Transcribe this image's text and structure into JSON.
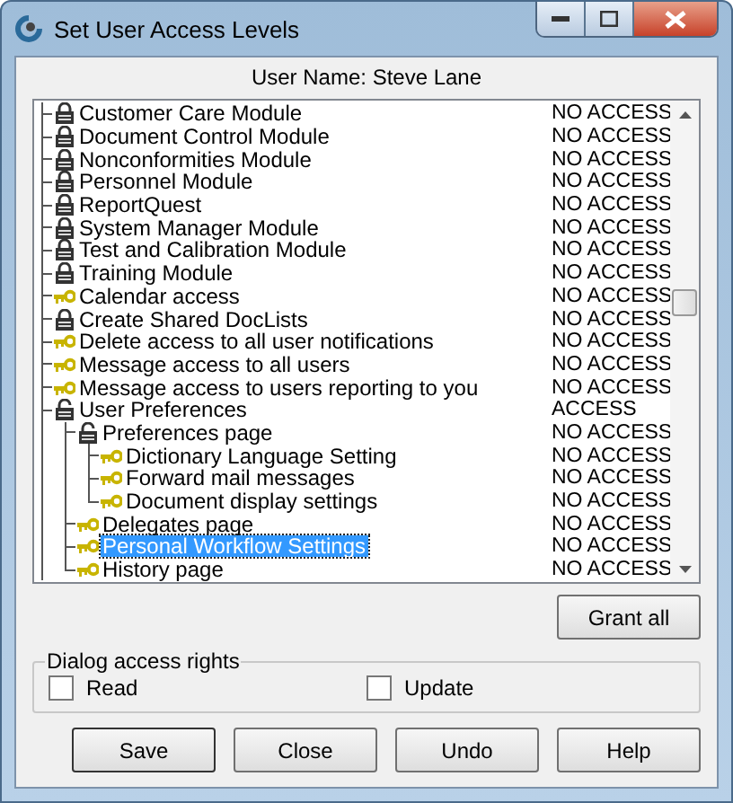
{
  "window": {
    "title": "Set User Access Levels"
  },
  "user_name": "User Name: Steve Lane",
  "tree": [
    {
      "label": "Customer Care Module",
      "kind": "lock",
      "access": "NO ACCESS",
      "selected": false
    },
    {
      "label": "Document Control Module",
      "kind": "lock",
      "access": "NO ACCESS",
      "selected": false
    },
    {
      "label": "Nonconformities Module",
      "kind": "lock",
      "access": "NO ACCESS",
      "selected": false
    },
    {
      "label": "Personnel Module",
      "kind": "lock",
      "access": "NO ACCESS",
      "selected": false
    },
    {
      "label": "ReportQuest",
      "kind": "lock",
      "access": "NO ACCESS",
      "selected": false
    },
    {
      "label": "System Manager Module",
      "kind": "lock",
      "access": "NO ACCESS",
      "selected": false
    },
    {
      "label": "Test and Calibration Module",
      "kind": "lock",
      "access": "NO ACCESS",
      "selected": false
    },
    {
      "label": "Training Module",
      "kind": "lock",
      "access": "NO ACCESS",
      "selected": false
    },
    {
      "label": "Calendar access",
      "kind": "key",
      "access": "NO ACCESS",
      "selected": false
    },
    {
      "label": "Create Shared DocLists",
      "kind": "lock",
      "access": "NO ACCESS",
      "selected": false
    },
    {
      "label": "Delete access to all user notifications",
      "kind": "key",
      "access": "NO ACCESS",
      "selected": false
    },
    {
      "label": "Message access to all users",
      "kind": "key",
      "access": "NO ACCESS",
      "selected": false
    },
    {
      "label": "Message access to users reporting to you",
      "kind": "key",
      "access": "NO ACCESS",
      "selected": false
    },
    {
      "label": "User Preferences",
      "kind": "unlock",
      "access": "ACCESS",
      "selected": false,
      "children": [
        {
          "label": "Preferences page",
          "kind": "unlock",
          "access": "NO ACCESS",
          "selected": false,
          "children": [
            {
              "label": "Dictionary Language Setting",
              "kind": "key",
              "access": "NO ACCESS",
              "selected": false
            },
            {
              "label": "Forward mail messages",
              "kind": "key",
              "access": "NO ACCESS",
              "selected": false
            },
            {
              "label": "Document display settings",
              "kind": "key",
              "access": "NO ACCESS",
              "selected": false
            }
          ]
        },
        {
          "label": "Delegates page",
          "kind": "key",
          "access": "NO ACCESS",
          "selected": false
        },
        {
          "label": "Personal Workflow Settings",
          "kind": "key",
          "access": "NO ACCESS",
          "selected": true
        },
        {
          "label": "History page",
          "kind": "key",
          "access": "NO ACCESS",
          "selected": false
        }
      ]
    }
  ],
  "grant_all": "Grant all",
  "dialog_access": {
    "title": "Dialog access rights",
    "options": [
      {
        "label": "Read",
        "checked": false
      },
      {
        "label": "Update",
        "checked": false
      }
    ]
  },
  "buttons": [
    "Save",
    "Close",
    "Undo",
    "Help"
  ]
}
